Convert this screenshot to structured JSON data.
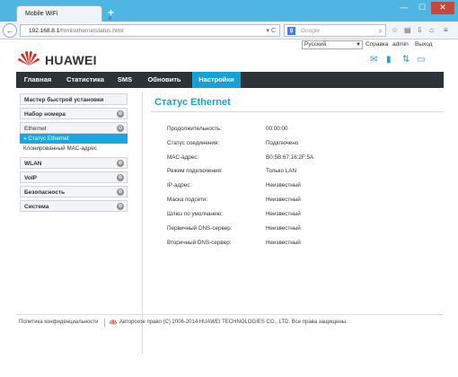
{
  "browser": {
    "tab_title": "Mobile WiFi",
    "tab_close": "×",
    "new_tab": "+",
    "window_min": "—",
    "window_max": "☐",
    "window_close": "✕",
    "back": "←",
    "url_host": "192.168.8.1",
    "url_path": "/html/ethernetstatus.html",
    "search_placeholder": "Google",
    "search_engine_letter": "g"
  },
  "top_links": {
    "language": "Русский",
    "help": "Справка",
    "user": "admin",
    "logout": "Выход"
  },
  "brand": {
    "name": "HUAWEI",
    "accent_color": "#16a2d6",
    "logo_color": "#e2231a"
  },
  "menu": {
    "items": [
      {
        "label": "Главная"
      },
      {
        "label": "Статистика"
      },
      {
        "label": "SMS"
      },
      {
        "label": "Обновить"
      },
      {
        "label": "Настройки",
        "active": true
      }
    ]
  },
  "sidebar": {
    "quick_setup": "Мастер быстрой установки",
    "dial": "Набор номера",
    "ethernet": "Ethernet",
    "ethernet_status": "» Статус Ethernet",
    "mac_clone": "Клонированный MAC-адрес",
    "wlan": "WLAN",
    "voip": "VoIP",
    "security": "Безопасность",
    "system": "Система",
    "toggle_symbol": "⊕",
    "toggle_symbol_open": "⊖"
  },
  "main": {
    "title": "Статус Ethernet",
    "rows": [
      {
        "label": "Продолжительность:",
        "value": "00:00:00"
      },
      {
        "label": "Статус соединения:",
        "value": "Подключено"
      },
      {
        "label": "MAC-адрес:",
        "value": "B0:5B:67:16:2F:5A"
      },
      {
        "label": "Режим подключения:",
        "value": "Только LAN"
      },
      {
        "label": "IP-адрес:",
        "value": "Неизвестный"
      },
      {
        "label": "Маска подсети:",
        "value": "Неизвестный"
      },
      {
        "label": "Шлюз по умолчанию:",
        "value": "Неизвестный"
      },
      {
        "label": "Первичный DNS-сервер:",
        "value": "Неизвестный"
      },
      {
        "label": "Вторичный DNS-сервер:",
        "value": "Неизвестный"
      }
    ]
  },
  "footer": {
    "privacy": "Политика конфиденциальности",
    "copyright": "Авторское право (C) 2006-2014 HUAWEI TECHNOLOGIES CO., LTD. Все права защищены."
  }
}
